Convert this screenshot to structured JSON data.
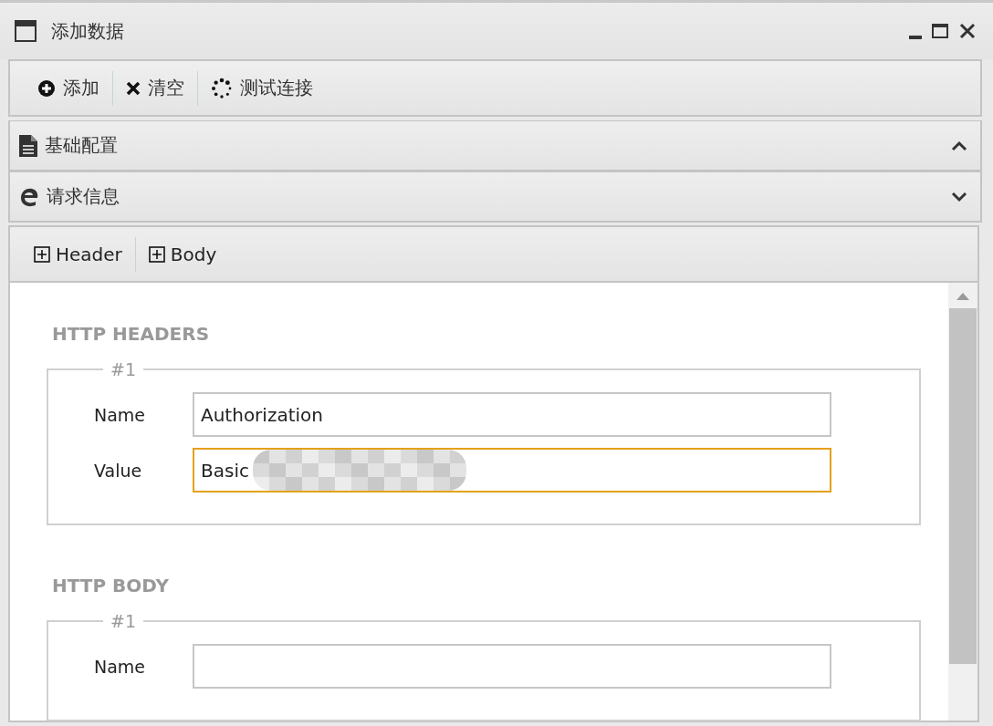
{
  "window": {
    "title": "添加数据"
  },
  "toolbar": [
    {
      "kind": "add",
      "label": "添加"
    },
    {
      "kind": "clear",
      "label": "清空"
    },
    {
      "kind": "test",
      "label": "测试连接"
    }
  ],
  "panels": [
    {
      "kind": "doc",
      "title": "基础配置",
      "expanded": true
    },
    {
      "kind": "web",
      "title": "请求信息",
      "expanded": false
    }
  ],
  "tabs": [
    {
      "label": "Header"
    },
    {
      "label": "Body"
    }
  ],
  "sections": [
    {
      "title": "HTTP HEADERS",
      "groups": [
        {
          "legend": "#1",
          "fields": [
            {
              "label": "Name",
              "value": "Authorization",
              "focused": false,
              "redacted": false
            },
            {
              "label": "Value",
              "value": "Basic",
              "focused": true,
              "redacted": true
            }
          ]
        }
      ]
    },
    {
      "title": "HTTP BODY",
      "groups": [
        {
          "legend": "#1",
          "fields": [
            {
              "label": "Name",
              "focused": false,
              "redacted": false
            }
          ]
        }
      ]
    }
  ]
}
